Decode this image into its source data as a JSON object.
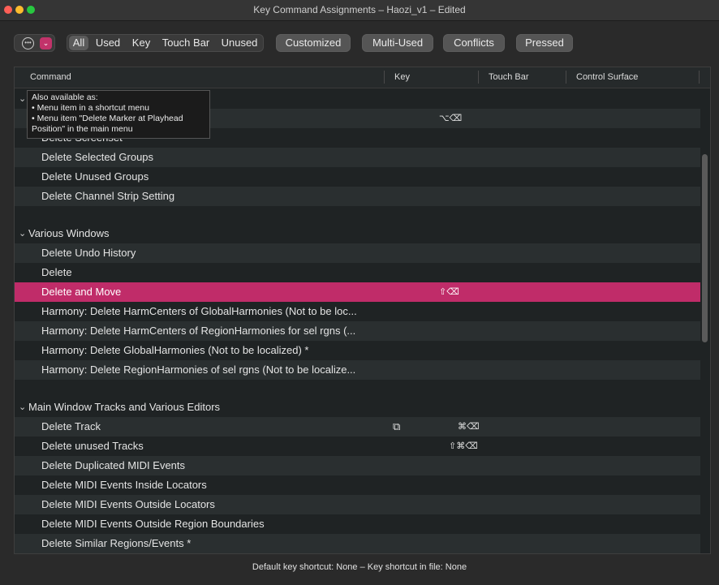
{
  "window": {
    "title": "Key Command Assignments – Haozi_v1 – Edited"
  },
  "toolbar": {
    "icons": [
      "ellipsis-circle-icon",
      "pink-chevron-icon"
    ],
    "filters": [
      "All",
      "Used",
      "Key",
      "Touch Bar",
      "Unused"
    ],
    "active_filter": "All",
    "buttons": [
      "Customized",
      "Multi-Used",
      "Conflicts",
      "Pressed"
    ]
  },
  "table": {
    "columns": [
      "Command",
      "Key",
      "Touch Bar",
      "Control Surface"
    ],
    "tooltip": {
      "line1": "Also available as:",
      "line2": "• Menu item in a shortcut menu",
      "line3": "• Menu item \"Delete Marker at Playhead",
      "line4": "Position\" in the main menu"
    },
    "hidden_row_key": "⌥⌫",
    "groups": [
      {
        "label": "",
        "rows": [
          {
            "command": "Delete Screenset",
            "key": ""
          },
          {
            "command": "Delete Selected Groups",
            "key": ""
          },
          {
            "command": "Delete Unused Groups",
            "key": ""
          },
          {
            "command": "Delete Channel Strip Setting",
            "key": ""
          }
        ]
      },
      {
        "label": "Various Windows",
        "rows": [
          {
            "command": "Delete Undo History",
            "key": ""
          },
          {
            "command": "Delete",
            "key": ""
          },
          {
            "command": "Delete and Move",
            "key": "⇧⌫"
          },
          {
            "command": "Harmony: Delete HarmCenters of GlobalHarmonies (Not to be loc...",
            "key": ""
          },
          {
            "command": "Harmony: Delete HarmCenters of RegionHarmonies for sel rgns (...",
            "key": ""
          },
          {
            "command": "Harmony: Delete GlobalHarmonies (Not to be localized) *",
            "key": ""
          },
          {
            "command": "Harmony: Delete RegionHarmonies of sel rgns (Not to be localize...",
            "key": ""
          }
        ]
      },
      {
        "label": "Main Window Tracks and Various Editors",
        "rows": [
          {
            "command": "Delete Track",
            "key": "⌘⌫"
          },
          {
            "command": "Delete unused Tracks",
            "key": "⇧⌘⌫"
          },
          {
            "command": "Delete Duplicated MIDI Events",
            "key": ""
          },
          {
            "command": "Delete MIDI Events Inside Locators",
            "key": ""
          },
          {
            "command": "Delete MIDI Events Outside Locators",
            "key": ""
          },
          {
            "command": "Delete MIDI Events Outside Region Boundaries",
            "key": ""
          },
          {
            "command": "Delete Similar Regions/Events *",
            "key": ""
          }
        ]
      }
    ]
  },
  "status": {
    "text": "Default key shortcut: None – Key shortcut in file: None"
  },
  "colors": {
    "selected_row": "#c02c69",
    "accent_pink": "#c2336a"
  }
}
